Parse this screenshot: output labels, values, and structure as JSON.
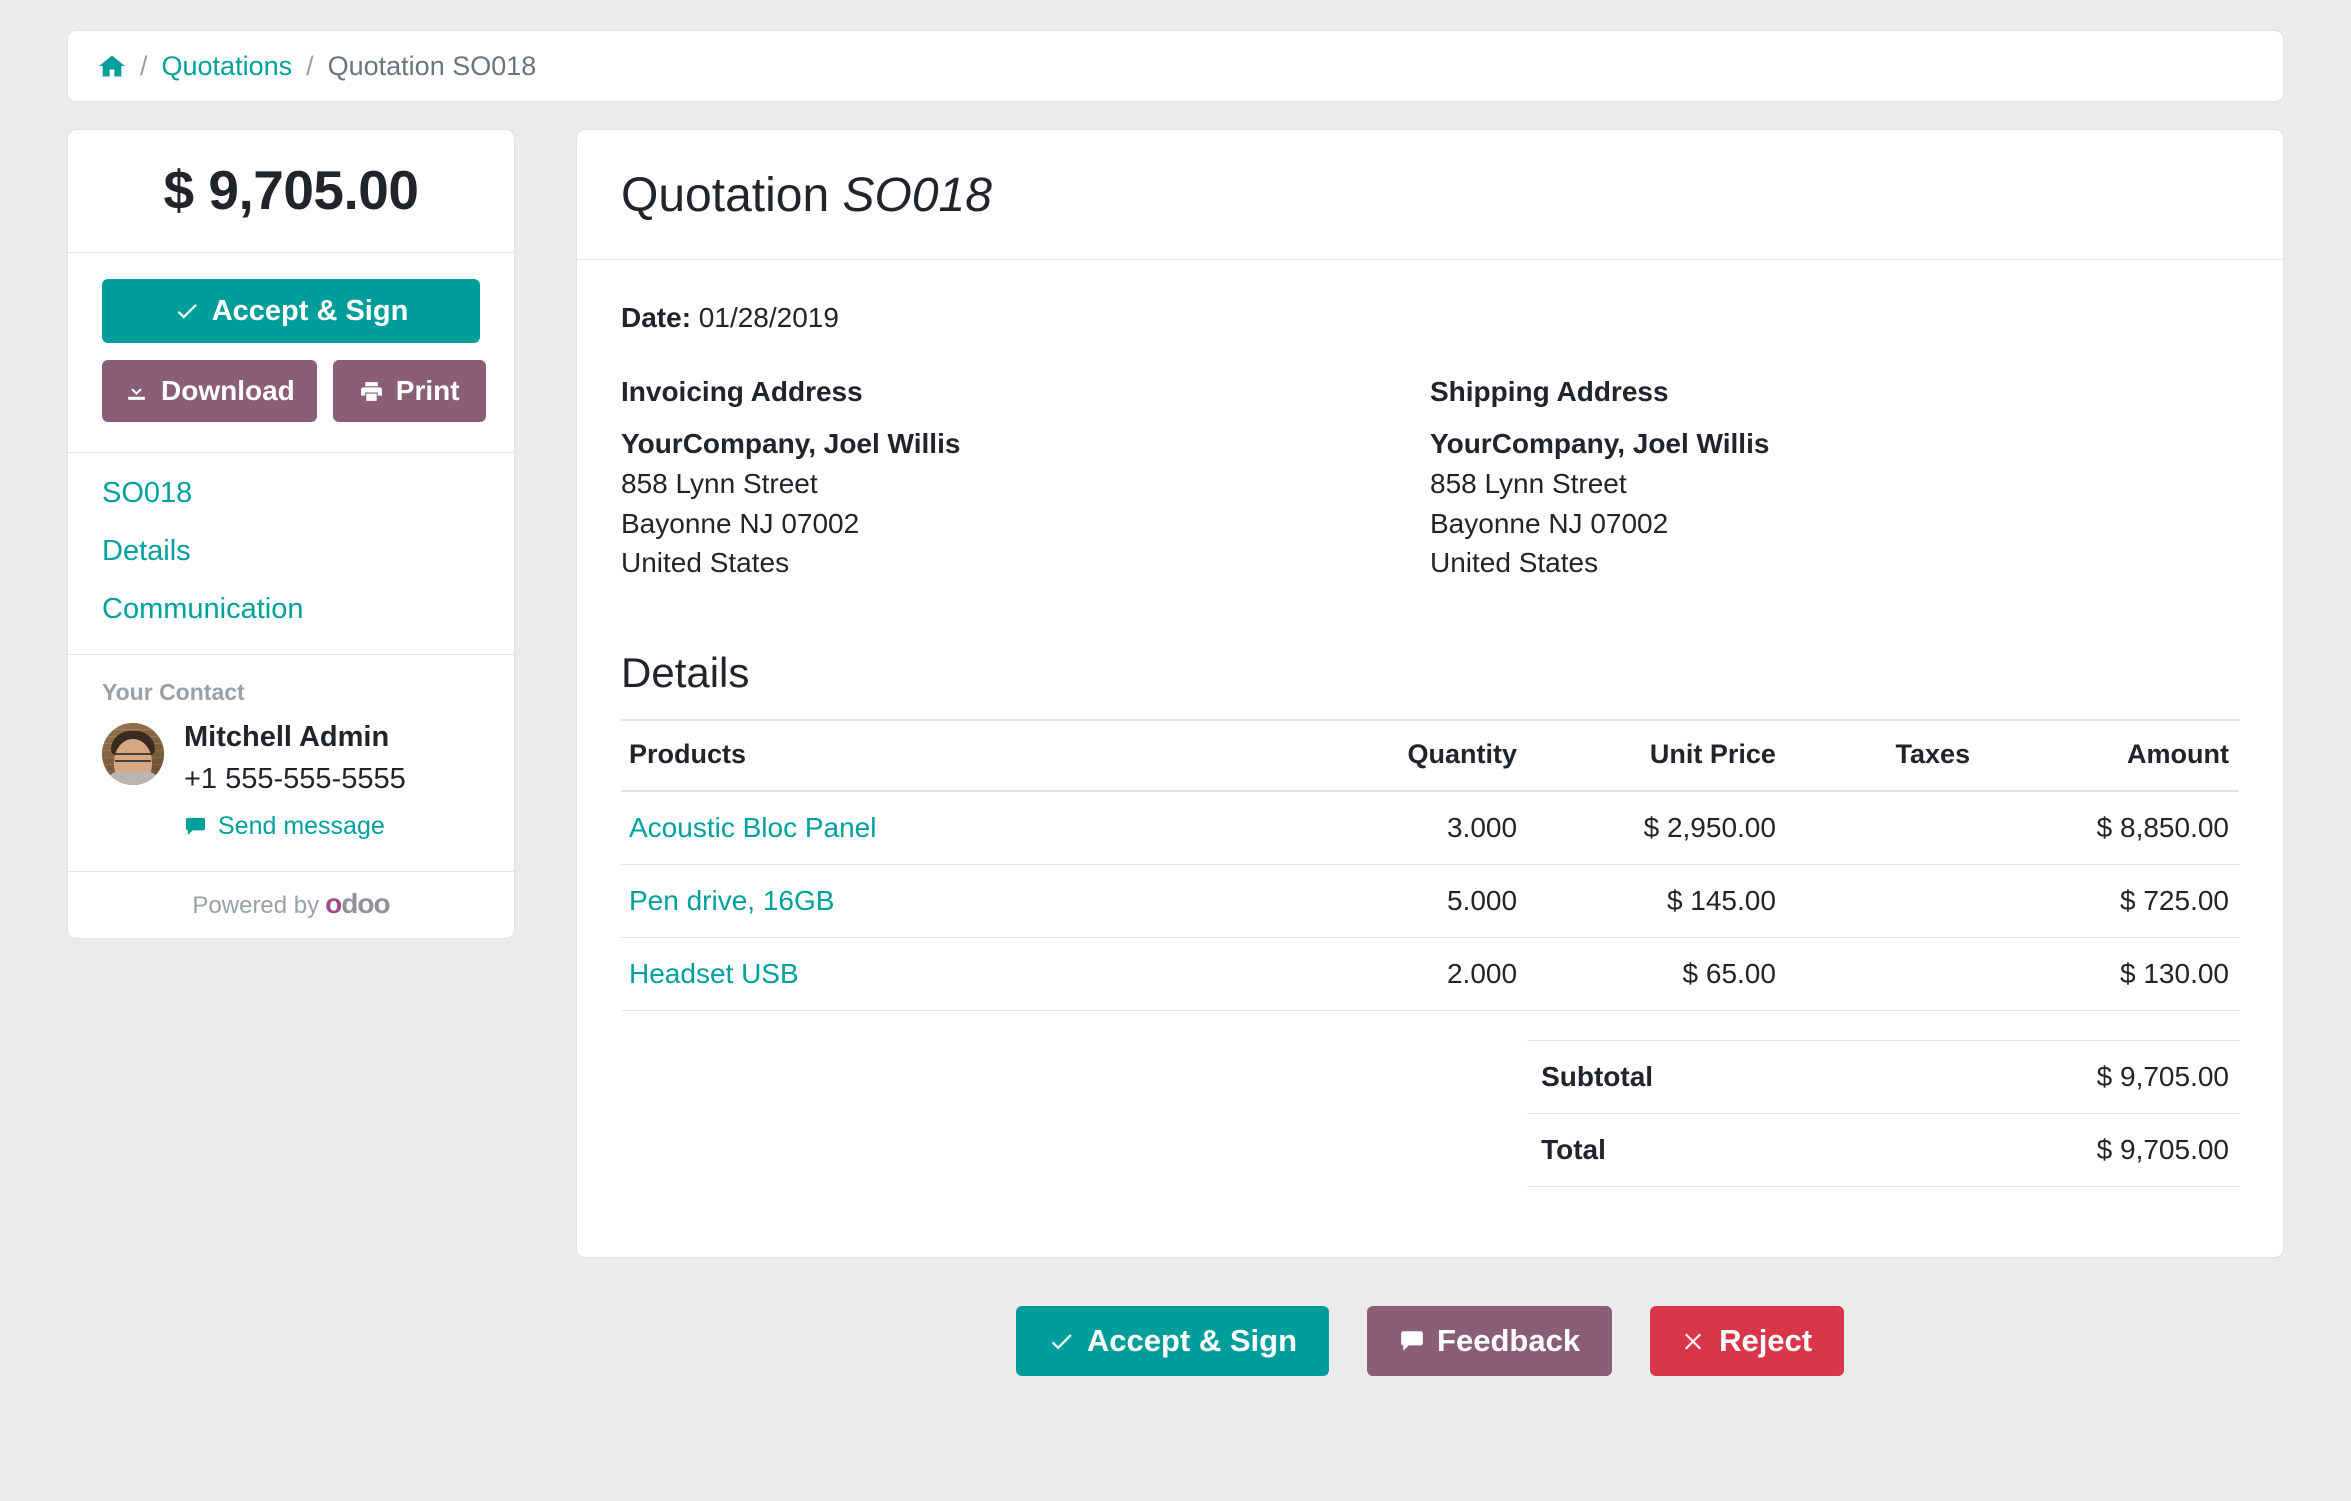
{
  "breadcrumb": {
    "home_icon": "home-icon",
    "separator": "/",
    "parent": "Quotations",
    "current": "Quotation SO018"
  },
  "sidebar": {
    "amount": "$ 9,705.00",
    "accept_label": "Accept & Sign",
    "download_label": "Download",
    "print_label": "Print",
    "links": [
      {
        "label": "SO018"
      },
      {
        "label": "Details"
      },
      {
        "label": "Communication"
      }
    ],
    "contact": {
      "title": "Your Contact",
      "name": "Mitchell Admin",
      "phone": "+1 555-555-5555",
      "send_message_label": "Send message"
    },
    "powered_by": "Powered by",
    "brand_first": "o",
    "brand_rest": "doo"
  },
  "main": {
    "title_prefix": "Quotation ",
    "title_ref": "SO018",
    "date_label": "Date:",
    "date_value": "01/28/2019",
    "invoicing": {
      "heading": "Invoicing Address",
      "name": "YourCompany, Joel Willis",
      "line1": "858 Lynn Street",
      "line2": "Bayonne NJ 07002",
      "line3": "United States"
    },
    "shipping": {
      "heading": "Shipping Address",
      "name": "YourCompany, Joel Willis",
      "line1": "858 Lynn Street",
      "line2": "Bayonne NJ 07002",
      "line3": "United States"
    },
    "details_heading": "Details",
    "table": {
      "headers": {
        "products": "Products",
        "quantity": "Quantity",
        "unit_price": "Unit Price",
        "taxes": "Taxes",
        "amount": "Amount"
      },
      "rows": [
        {
          "product": "Acoustic Bloc Panel",
          "quantity": "3.000",
          "unit_price": "$ 2,950.00",
          "taxes": "",
          "amount": "$ 8,850.00"
        },
        {
          "product": "Pen drive, 16GB",
          "quantity": "5.000",
          "unit_price": "$ 145.00",
          "taxes": "",
          "amount": "$ 725.00"
        },
        {
          "product": "Headset USB",
          "quantity": "2.000",
          "unit_price": "$ 65.00",
          "taxes": "",
          "amount": "$ 130.00"
        }
      ],
      "subtotal_label": "Subtotal",
      "subtotal_value": "$ 9,705.00",
      "total_label": "Total",
      "total_value": "$ 9,705.00"
    }
  },
  "footer": {
    "accept_label": "Accept & Sign",
    "feedback_label": "Feedback",
    "reject_label": "Reject"
  },
  "colors": {
    "teal": "#009e9b",
    "purple": "#8a5d78",
    "red": "#d9364a",
    "page_bg": "#ebebeb",
    "brand_magenta": "#9c4d86"
  }
}
